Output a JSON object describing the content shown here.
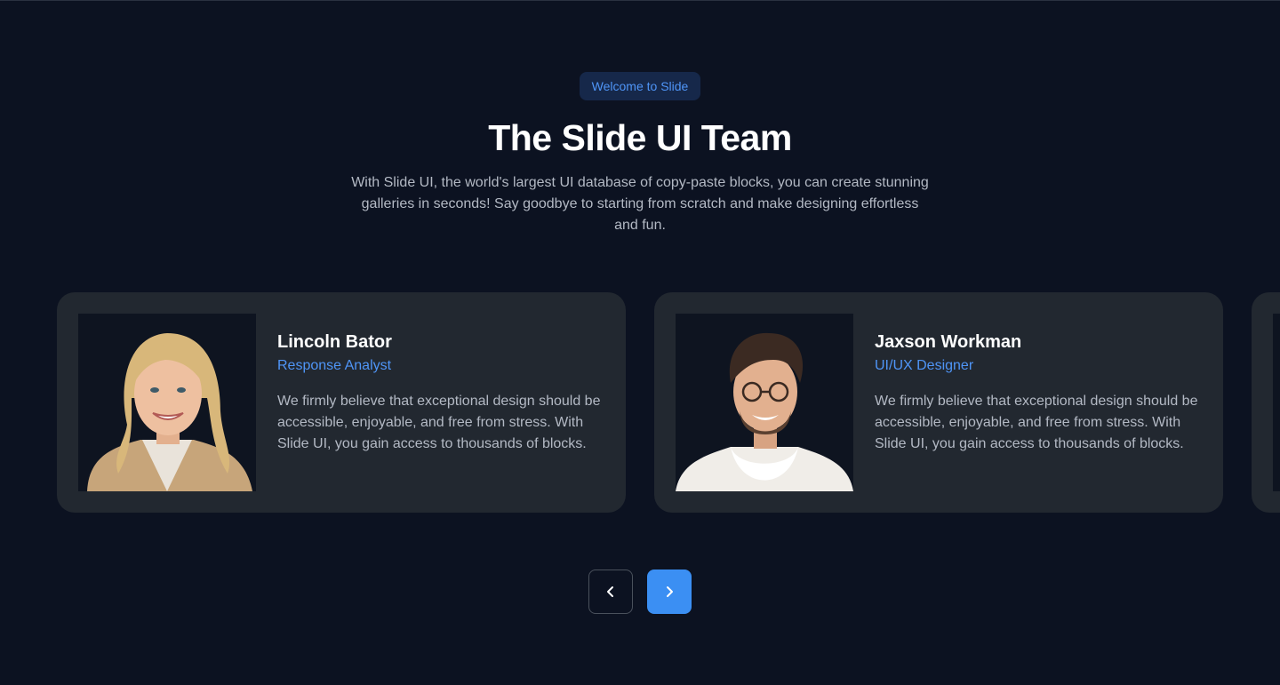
{
  "header": {
    "badge": "Welcome to Slide",
    "title": "The Slide UI Team",
    "subtitle": "With Slide UI, the world's largest UI database of copy-paste blocks, you can create stunning galleries in seconds! Say goodbye to starting from scratch and make designing effortless and fun."
  },
  "team": [
    {
      "name": "Lincoln Bator",
      "role": "Response Analyst",
      "description": "We firmly believe that exceptional design should be accessible, enjoyable, and free from stress. With Slide UI, you gain access to thousands of blocks."
    },
    {
      "name": "Jaxson Workman",
      "role": "UI/UX Designer",
      "description": "We firmly believe that exceptional design should be accessible, enjoyable, and free from stress. With Slide UI, you gain access to thousands of blocks."
    }
  ],
  "icons": {
    "prev": "chevron-left-icon",
    "next": "chevron-right-icon"
  },
  "colors": {
    "background": "#0c1221",
    "card": "#222830",
    "accent": "#4f95f7",
    "button_primary": "#3b8ff3"
  }
}
